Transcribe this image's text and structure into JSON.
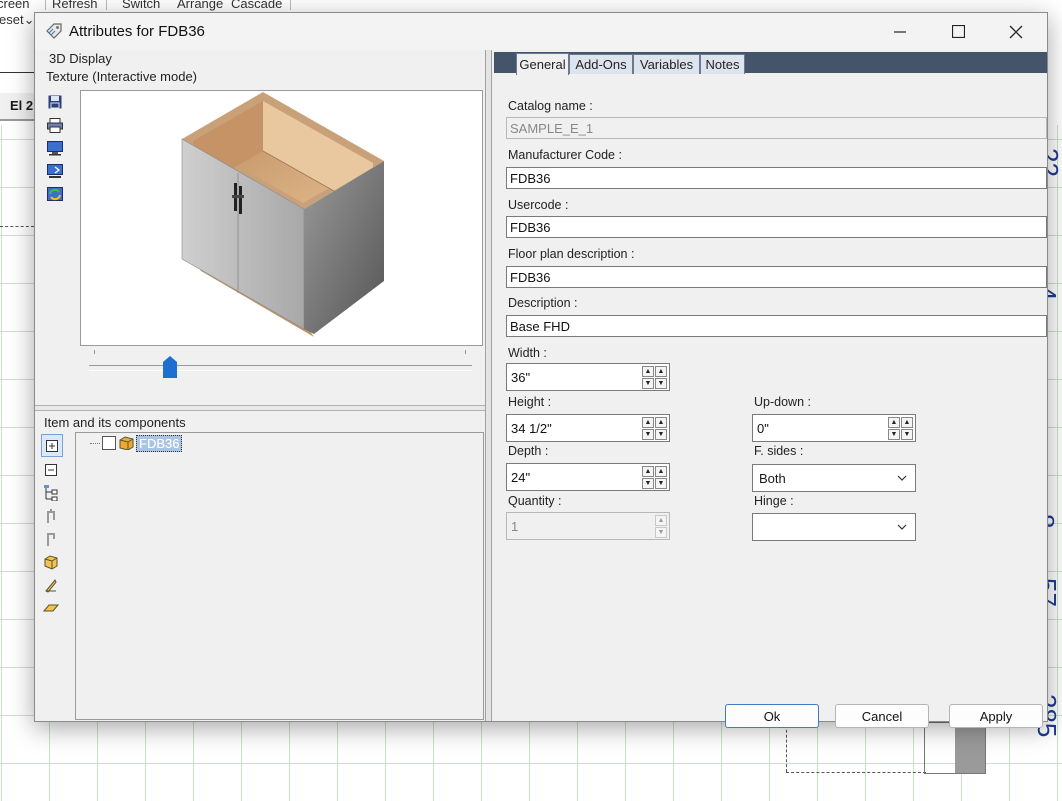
{
  "background_app": {
    "menu": [
      "creen",
      "Refresh",
      "Switch",
      "Arrange",
      "Cascade"
    ],
    "submenu": "eset",
    "tab_label": "El 2",
    "blue_labels": [
      "22",
      "4",
      "57",
      "285",
      "8"
    ]
  },
  "dialog": {
    "title": "Attributes for FDB36",
    "left": {
      "display_header": "3D Display",
      "display_mode": "Texture (Interactive mode)",
      "components_header": "Item and its components",
      "tree_item": "FDB36"
    },
    "tabs": [
      "General",
      "Add-Ons",
      "Variables",
      "Notes"
    ],
    "fields": {
      "catalog_name": {
        "label": "Catalog name :",
        "value": "SAMPLE_E_1"
      },
      "manufacturer_code": {
        "label": "Manufacturer Code :",
        "value": "FDB36"
      },
      "usercode": {
        "label": "Usercode :",
        "value": "FDB36"
      },
      "floor_plan_description": {
        "label": "Floor plan description :",
        "value": "FDB36"
      },
      "description": {
        "label": "Description :",
        "value": "Base FHD"
      },
      "width": {
        "label": "Width :",
        "value": "36\""
      },
      "height": {
        "label": "Height :",
        "value": "34 1/2\""
      },
      "depth": {
        "label": "Depth :",
        "value": "24\""
      },
      "quantity": {
        "label": "Quantity :",
        "value": "1"
      },
      "up_down": {
        "label": "Up-down :",
        "value": "0\""
      },
      "f_sides": {
        "label": "F. sides :",
        "value": "Both"
      },
      "hinge": {
        "label": "Hinge :",
        "value": ""
      }
    },
    "buttons": {
      "ok": "Ok",
      "cancel": "Cancel",
      "apply": "Apply"
    }
  }
}
